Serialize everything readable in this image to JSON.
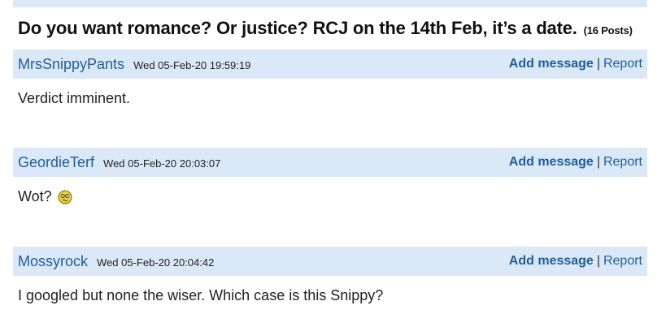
{
  "thread": {
    "title": "Do you want romance? Or justice? RCJ on the 14th Feb, it’s a date.",
    "post_count": "(16 Posts)"
  },
  "actions": {
    "add_message": "Add message",
    "separator": "|",
    "report": "Report"
  },
  "posts": [
    {
      "author": "MrsSnippyPants",
      "timestamp": "Wed 05-Feb-20 19:59:19",
      "message": "Verdict imminent."
    },
    {
      "author": "GeordieTerf",
      "timestamp": "Wed 05-Feb-20 20:03:07",
      "message": "Wot?",
      "icon": "confused-smiley-icon"
    },
    {
      "author": "Mossyrock",
      "timestamp": "Wed 05-Feb-20 20:04:42",
      "message": "I googled but none the wiser. Which case is this Snippy?"
    }
  ],
  "colors": {
    "header_bg": "#dbe8f8",
    "link": "#1f5e9a",
    "smiley": "#f2d327"
  }
}
